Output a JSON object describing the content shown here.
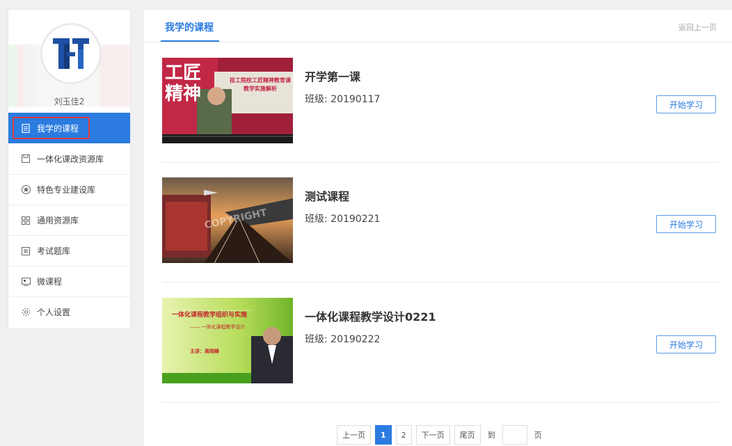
{
  "sidebar": {
    "username": "刘玉佳2",
    "items": [
      {
        "label": "我学的课程",
        "icon": "document-icon",
        "active": true
      },
      {
        "label": "一体化课改资源库",
        "icon": "save-icon",
        "active": false
      },
      {
        "label": "特色专业建设库",
        "icon": "star-circle-icon",
        "active": false
      },
      {
        "label": "通用资源库",
        "icon": "grid-icon",
        "active": false
      },
      {
        "label": "考试题库",
        "icon": "list-icon",
        "active": false
      },
      {
        "label": "微课程",
        "icon": "video-board-icon",
        "active": false
      },
      {
        "label": "个人设置",
        "icon": "gear-icon",
        "active": false
      }
    ]
  },
  "main": {
    "title": "我学的课程",
    "back_link": "返回上一页",
    "courses": [
      {
        "title": "开学第一课",
        "class": "班级: 20190117",
        "button": "开始学习",
        "thumb": {
          "line1": "工匠",
          "line2": "精神",
          "line3": "技工院校工匠精神教育课",
          "line4": "教学实施解析"
        }
      },
      {
        "title": "测试课程",
        "class": "班级: 20190221",
        "button": "开始学习",
        "thumb": {
          "watermark": "COPYRIGHT"
        }
      },
      {
        "title": "一体化课程教学设计0221",
        "class": "班级: 20190222",
        "button": "开始学习",
        "thumb": {
          "line1": "一体化课程教学组织与实施",
          "line2": "—— 一体化课程教学设计",
          "line3": "主讲：周晓峰"
        }
      }
    ]
  },
  "pager": {
    "prev": "上一页",
    "pages": [
      "1",
      "2"
    ],
    "current": "1",
    "next": "下一页",
    "last": "尾页",
    "goto": "到",
    "page_unit": "页"
  },
  "colors": {
    "accent": "#2b7be0",
    "highlight_box": "#e23b3b"
  }
}
